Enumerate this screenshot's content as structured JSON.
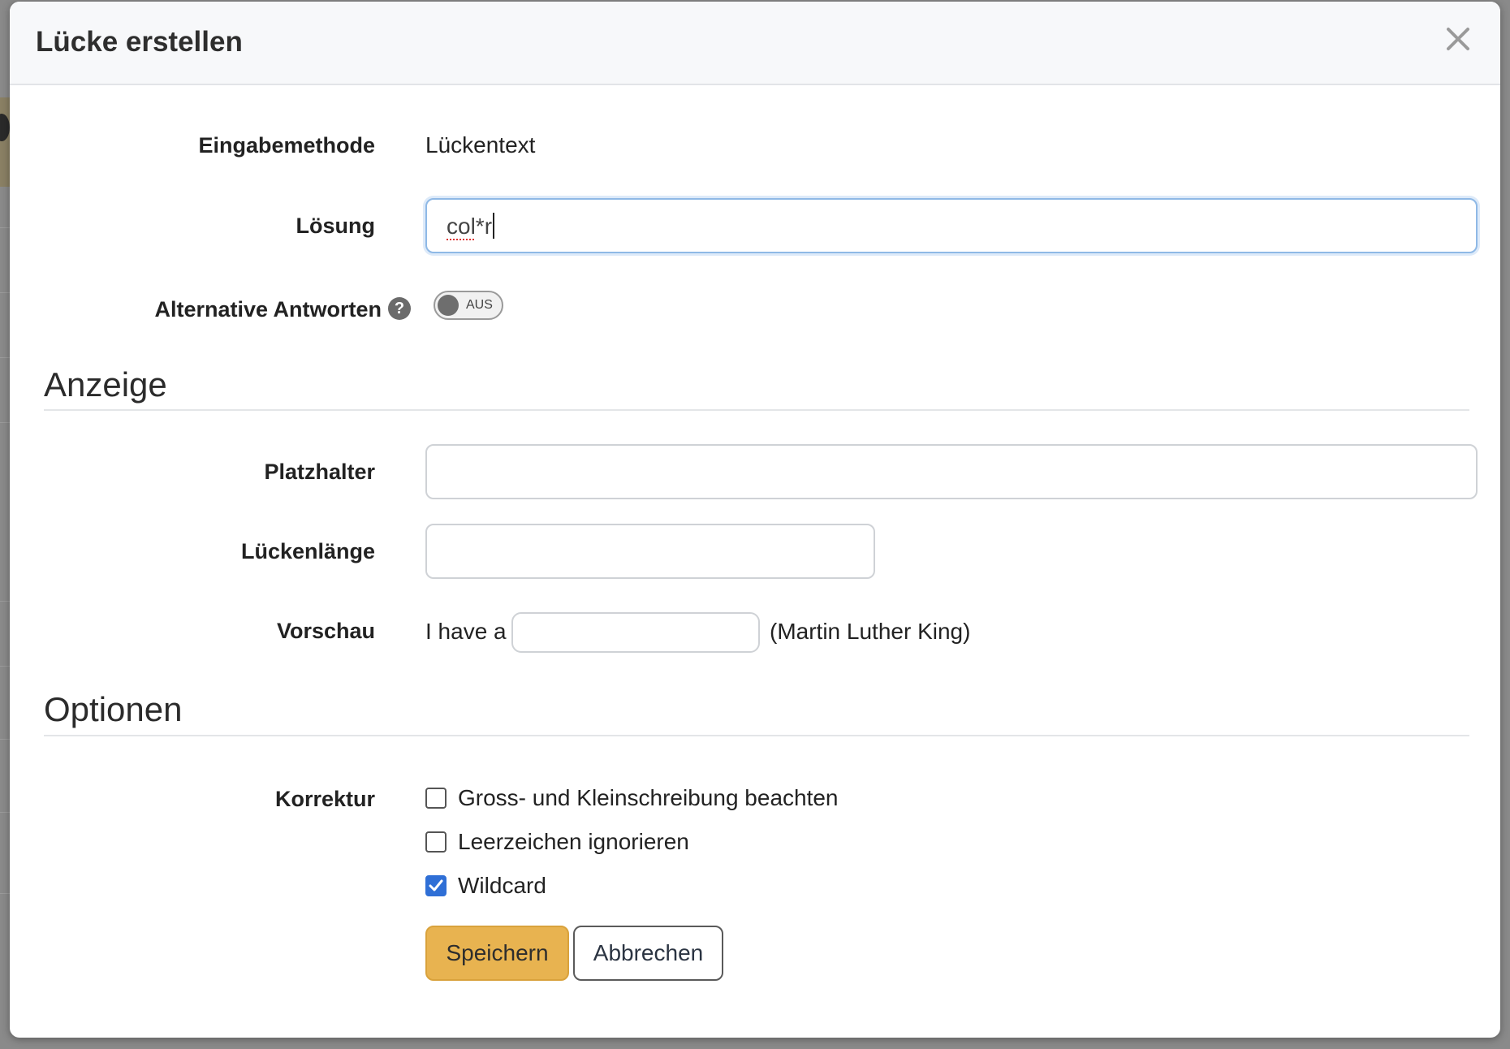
{
  "modal": {
    "title": "Lücke erstellen"
  },
  "form": {
    "input_method": {
      "label": "Eingabemethode",
      "value": "Lückentext"
    },
    "solution": {
      "label": "Lösung",
      "value_squiggled": "col",
      "value_rest": "*r"
    },
    "alternatives": {
      "label": "Alternative Antworten",
      "toggle_text": "AUS"
    }
  },
  "display_section": {
    "title": "Anzeige",
    "placeholder_label": "Platzhalter",
    "placeholder_value": "",
    "gap_length_label": "Lückenlänge",
    "gap_length_value": "",
    "preview_label": "Vorschau",
    "preview_before": "I have a",
    "preview_after": "(Martin Luther King)"
  },
  "options_section": {
    "title": "Optionen",
    "correction_label": "Korrektur",
    "checkboxes": [
      {
        "label": "Gross- und Kleinschreibung beachten",
        "checked": false
      },
      {
        "label": "Leerzeichen ignorieren",
        "checked": false
      },
      {
        "label": "Wildcard",
        "checked": true
      }
    ]
  },
  "buttons": {
    "save": "Speichern",
    "cancel": "Abbrechen"
  },
  "colors": {
    "primary_button": "#e8b350",
    "checkbox_checked": "#2f6fd6",
    "focus_border": "#8fb9e6"
  },
  "icons": {
    "close": "close-icon",
    "help": "question-circle-icon",
    "check": "check-icon"
  }
}
